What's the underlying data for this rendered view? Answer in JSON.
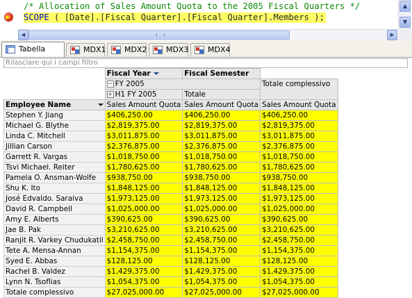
{
  "editor": {
    "line1": "/* Allocation of Sales Amount Quota to the 2005 Fiscal Quarters */",
    "line2_kw": "SCOPE",
    "line2_rest": " ( [Date].[Fiscal Quarter].[Fiscal Quarter].Members );"
  },
  "tabs": [
    {
      "label": "Tabella pivot",
      "icon": "pivot-table-icon"
    },
    {
      "label": "MDX1",
      "icon": "mdx-query-icon"
    },
    {
      "label": "MDX2",
      "icon": "mdx-query-icon"
    },
    {
      "label": "MDX3",
      "icon": "mdx-query-icon"
    },
    {
      "label": "MDX4",
      "icon": "mdx-query-icon"
    }
  ],
  "pivot": {
    "filter_placeholder": "Rilasciare qui i campi filtro",
    "col_field_1": "Fiscal Year",
    "col_field_2": "Fiscal Semester",
    "member_fy": "FY 2005",
    "member_h1": "H1 FY 2005",
    "subtotal_label": "Totale",
    "grand_total_label": "Totale complessivo",
    "measure": "Sales Amount Quota",
    "row_field": "Employee Name",
    "rows": [
      {
        "name": "Stephen Y. Jiang",
        "v": [
          "$406,250.00",
          "$406,250.00",
          "$406,250.00"
        ]
      },
      {
        "name": "Michael G. Blythe",
        "v": [
          "$2,819,375.00",
          "$2,819,375.00",
          "$2,819,375.00"
        ]
      },
      {
        "name": "Linda C. Mitchell",
        "v": [
          "$3,011,875.00",
          "$3,011,875.00",
          "$3,011,875.00"
        ]
      },
      {
        "name": "Jillian Carson",
        "v": [
          "$2,376,875.00",
          "$2,376,875.00",
          "$2,376,875.00"
        ]
      },
      {
        "name": "Garrett R. Vargas",
        "v": [
          "$1,018,750.00",
          "$1,018,750.00",
          "$1,018,750.00"
        ]
      },
      {
        "name": "Tsvi Michael. Reiter",
        "v": [
          "$1,780,625.00",
          "$1,780,625.00",
          "$1,780,625.00"
        ]
      },
      {
        "name": "Pamela O. Ansman-Wolfe",
        "v": [
          "$938,750.00",
          "$938,750.00",
          "$938,750.00"
        ]
      },
      {
        "name": "Shu K. Ito",
        "v": [
          "$1,848,125.00",
          "$1,848,125.00",
          "$1,848,125.00"
        ]
      },
      {
        "name": "José Edvaldo. Saraiva",
        "v": [
          "$1,973,125.00",
          "$1,973,125.00",
          "$1,973,125.00"
        ]
      },
      {
        "name": "David R. Campbell",
        "v": [
          "$1,025,000.00",
          "$1,025,000.00",
          "$1,025,000.00"
        ]
      },
      {
        "name": "Amy E. Alberts",
        "v": [
          "$390,625.00",
          "$390,625.00",
          "$390,625.00"
        ]
      },
      {
        "name": "Jae B. Pak",
        "v": [
          "$3,210,625.00",
          "$3,210,625.00",
          "$3,210,625.00"
        ]
      },
      {
        "name": "Ranjit R. Varkey Chudukatil",
        "v": [
          "$2,458,750.00",
          "$2,458,750.00",
          "$2,458,750.00"
        ]
      },
      {
        "name": "Tete A. Mensa-Annan",
        "v": [
          "$1,154,375.00",
          "$1,154,375.00",
          "$1,154,375.00"
        ]
      },
      {
        "name": "Syed E. Abbas",
        "v": [
          "$128,125.00",
          "$128,125.00",
          "$128,125.00"
        ]
      },
      {
        "name": "Rachel B. Valdez",
        "v": [
          "$1,429,375.00",
          "$1,429,375.00",
          "$1,429,375.00"
        ]
      },
      {
        "name": "Lynn N. Tsoflias",
        "v": [
          "$1,054,375.00",
          "$1,054,375.00",
          "$1,054,375.00"
        ]
      }
    ],
    "total_row": {
      "name": "Totale complessivo",
      "v": [
        "$27,025,000.00",
        "$27,025,000.00",
        "$27,025,000.00"
      ]
    }
  },
  "colors": {
    "value_cell": "#ffff00",
    "highlight": "#ffff66",
    "comment": "#0a8a0a",
    "keyword": "#0000c8"
  }
}
